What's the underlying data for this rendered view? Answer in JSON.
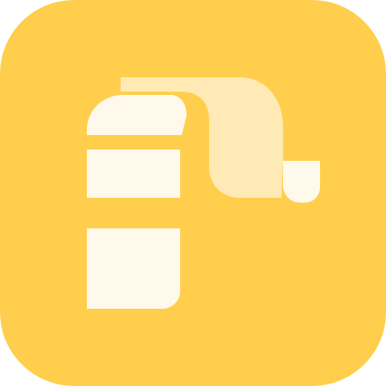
{
  "icon": {
    "name": "paper-scroll-app-icon",
    "colors": {
      "background": "#FFCE4C",
      "paper": "#FFF9EC",
      "curl": "#FFE9B4"
    }
  }
}
